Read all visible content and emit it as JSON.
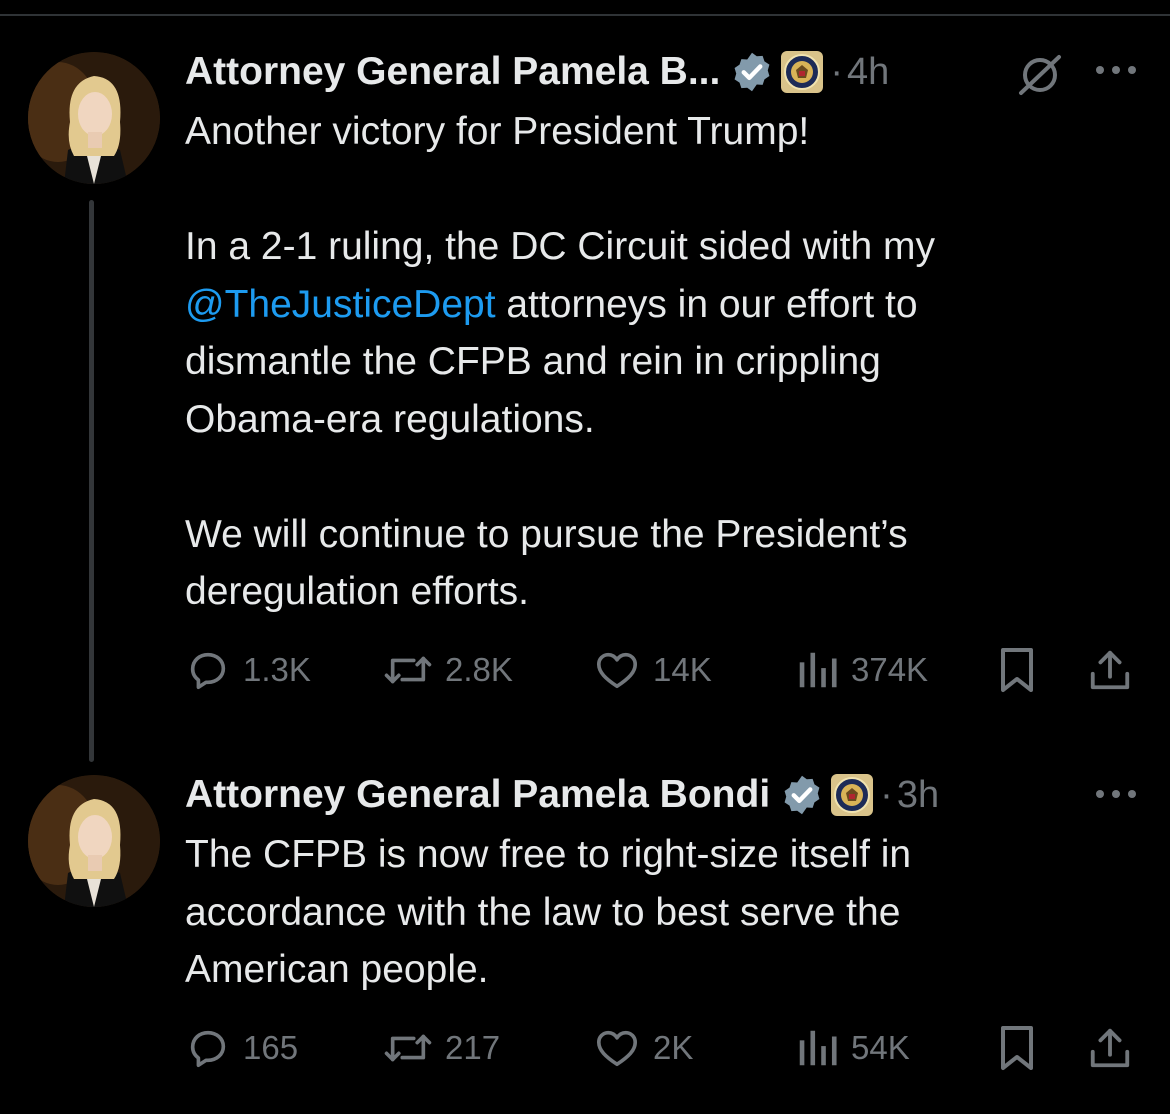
{
  "tweets": [
    {
      "author": "Attorney General Pamela B...",
      "time": "4h",
      "separator": "·",
      "lines": [
        "Another victory for President Trump!",
        "",
        "In a 2-1 ruling, the DC Circuit sided with my",
        {
          "mention": "@TheJusticeDept",
          "rest": " attorneys in our effort to"
        },
        "dismantle the CFPB and rein in crippling",
        "Obama-era regulations.",
        "",
        "We will continue to pursue the President’s",
        "deregulation efforts."
      ],
      "stats": {
        "replies": "1.3K",
        "reposts": "2.8K",
        "likes": "14K",
        "views": "374K"
      }
    },
    {
      "author": "Attorney General Pamela Bondi",
      "time": "3h",
      "separator": "·",
      "lines": [
        "The CFPB is now free to right-size itself in",
        "accordance with the law to best serve the",
        "American people."
      ],
      "stats": {
        "replies": "165",
        "reposts": "217",
        "likes": "2K",
        "views": "54K"
      }
    }
  ],
  "icons": {
    "verified": "verified-badge-icon",
    "affiliate": "doj-seal-icon",
    "grok": "grok-icon",
    "more": "more-icon",
    "reply": "reply-icon",
    "repost": "repost-icon",
    "like": "like-icon",
    "views": "views-icon",
    "bookmark": "bookmark-icon",
    "share": "share-icon"
  },
  "colors": {
    "background": "#000000",
    "text": "#e7e9ea",
    "muted": "#71767b",
    "link": "#1d9bf0",
    "verified": "#829aab"
  }
}
